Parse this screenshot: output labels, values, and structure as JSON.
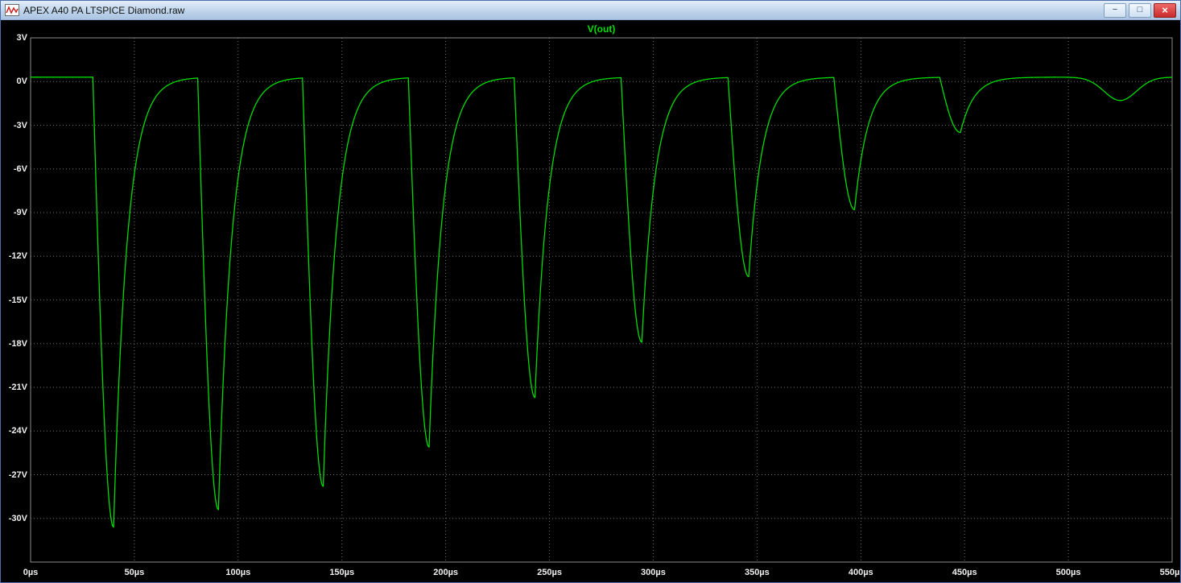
{
  "window": {
    "title": "APEX A40 PA LTSPICE Diamond.raw",
    "controls": {
      "minimize_glyph": "−",
      "maximize_glyph": "□",
      "close_glyph": "×"
    }
  },
  "chart_data": {
    "type": "line",
    "title": "V(out)",
    "x_unit": "µs",
    "y_unit": "V",
    "xlim": [
      0,
      550
    ],
    "ylim": [
      -33,
      3
    ],
    "grid": true,
    "legend_position": "top-center",
    "colors": {
      "background": "#000000",
      "grid": "#6e6e6e",
      "border": "#8c8c8c",
      "tick_text": "#f0f0f0",
      "trace": "#00dc00",
      "title": "#00e000"
    },
    "x_ticks": [
      {
        "t": 0,
        "label": "0µs"
      },
      {
        "t": 50,
        "label": "50µs"
      },
      {
        "t": 100,
        "label": "100µs"
      },
      {
        "t": 150,
        "label": "150µs"
      },
      {
        "t": 200,
        "label": "200µs"
      },
      {
        "t": 250,
        "label": "250µs"
      },
      {
        "t": 300,
        "label": "300µs"
      },
      {
        "t": 350,
        "label": "350µs"
      },
      {
        "t": 400,
        "label": "400µs"
      },
      {
        "t": 450,
        "label": "450µs"
      },
      {
        "t": 500,
        "label": "500µs"
      },
      {
        "t": 550,
        "label": "550µs"
      }
    ],
    "y_ticks": [
      {
        "v": 3,
        "label": "3V"
      },
      {
        "v": 0,
        "label": "0V"
      },
      {
        "v": -3,
        "label": "-3V"
      },
      {
        "v": -6,
        "label": "-6V"
      },
      {
        "v": -9,
        "label": "-9V"
      },
      {
        "v": -12,
        "label": "-12V"
      },
      {
        "v": -15,
        "label": "-15V"
      },
      {
        "v": -18,
        "label": "-18V"
      },
      {
        "v": -21,
        "label": "-21V"
      },
      {
        "v": -24,
        "label": "-24V"
      },
      {
        "v": -27,
        "label": "-27V"
      },
      {
        "v": -30,
        "label": "-30V"
      }
    ],
    "y_grid_values": [
      3,
      0,
      -3,
      -6,
      -9,
      -12,
      -15,
      -18,
      -21,
      -24,
      -27,
      -30,
      -33
    ],
    "series": [
      {
        "name": "V(out)",
        "color": "#00dc00",
        "baseline_v": 0.3,
        "waveform": "negative pulse train, ~51µs period, amplitude decaying each cycle",
        "fall_us": 10,
        "tau_us": 6.5,
        "pulses": [
          {
            "t_us": 40,
            "v_min": -30.6
          },
          {
            "t_us": 90.5,
            "v_min": -29.4
          },
          {
            "t_us": 141,
            "v_min": -27.8
          },
          {
            "t_us": 192,
            "v_min": -25.1
          },
          {
            "t_us": 243,
            "v_min": -21.7
          },
          {
            "t_us": 294.5,
            "v_min": -17.9
          },
          {
            "t_us": 346,
            "v_min": -13.4
          },
          {
            "t_us": 397,
            "v_min": -8.8
          },
          {
            "t_us": 448,
            "v_min": -3.5
          },
          {
            "t_us": 525,
            "v_min": -1.3,
            "shape": "round",
            "w_us": 11
          }
        ]
      }
    ]
  }
}
